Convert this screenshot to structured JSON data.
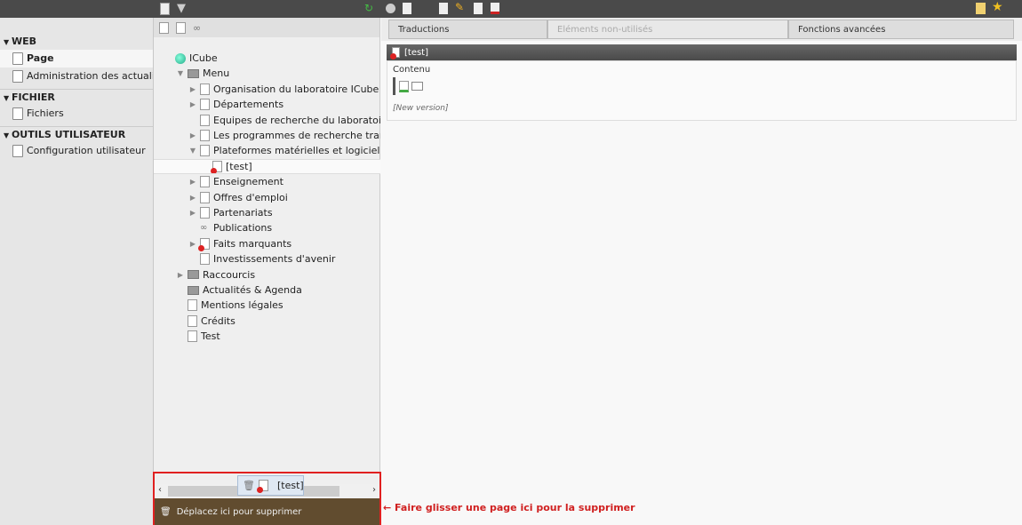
{
  "modules": [
    {
      "header": "WEB",
      "items": [
        {
          "label": "Page",
          "active": true,
          "icon": "page-tv-icon"
        },
        {
          "label": "Administration des actualités",
          "icon": "news-admin-icon"
        }
      ]
    },
    {
      "header": "FICHIER",
      "items": [
        {
          "label": "Fichiers",
          "icon": "files-icon"
        }
      ]
    },
    {
      "header": "OUTILS UTILISATEUR",
      "items": [
        {
          "label": "Configuration utilisateur",
          "icon": "user-config-icon"
        }
      ]
    }
  ],
  "tree": [
    {
      "label": "ICube",
      "level": 0,
      "icon": "globe"
    },
    {
      "label": "Menu",
      "level": 1,
      "icon": "folder",
      "toggle": "open"
    },
    {
      "label": "Organisation du laboratoire ICube",
      "level": 2,
      "icon": "page",
      "toggle": "closed"
    },
    {
      "label": "Départements",
      "level": 2,
      "icon": "page",
      "toggle": "closed"
    },
    {
      "label": "Equipes de recherche du laboratoire ICube",
      "level": 2,
      "icon": "page"
    },
    {
      "label": "Les programmes de recherche transversaux",
      "level": 2,
      "icon": "page",
      "toggle": "closed"
    },
    {
      "label": "Plateformes matérielles et logicielles",
      "level": 2,
      "icon": "page",
      "toggle": "open"
    },
    {
      "label": "[test]",
      "level": 3,
      "icon": "page-red",
      "selected": true
    },
    {
      "label": "Enseignement",
      "level": 2,
      "icon": "page",
      "toggle": "closed"
    },
    {
      "label": "Offres d'emploi",
      "level": 2,
      "icon": "shortcut",
      "toggle": "closed"
    },
    {
      "label": "Partenariats",
      "level": 2,
      "icon": "shortcut",
      "toggle": "closed"
    },
    {
      "label": "Publications",
      "level": 2,
      "icon": "link"
    },
    {
      "label": "Faits marquants",
      "level": 2,
      "icon": "page-red",
      "toggle": "closed"
    },
    {
      "label": "Investissements d'avenir",
      "level": 2,
      "icon": "page"
    },
    {
      "label": "Raccourcis",
      "level": 1,
      "icon": "folder",
      "toggle": "closed"
    },
    {
      "label": "Actualités & Agenda",
      "level": 1,
      "icon": "folder"
    },
    {
      "label": "Mentions légales",
      "level": 1,
      "icon": "page"
    },
    {
      "label": "Crédits",
      "level": 1,
      "icon": "page"
    },
    {
      "label": "Test",
      "level": 1,
      "icon": "page"
    }
  ],
  "drag": {
    "label": "[test]"
  },
  "trash": {
    "label": "Déplacez ici pour supprimer"
  },
  "annotation": "← Faire glisser une page ici pour la supprimer",
  "tabs": [
    {
      "label": "Traductions"
    },
    {
      "label": "Eléments non-utilisés",
      "disabled": true
    },
    {
      "label": "Fonctions avancées"
    }
  ],
  "panel": {
    "title": "[test]",
    "column": "Contenu",
    "version": "[New version]"
  }
}
